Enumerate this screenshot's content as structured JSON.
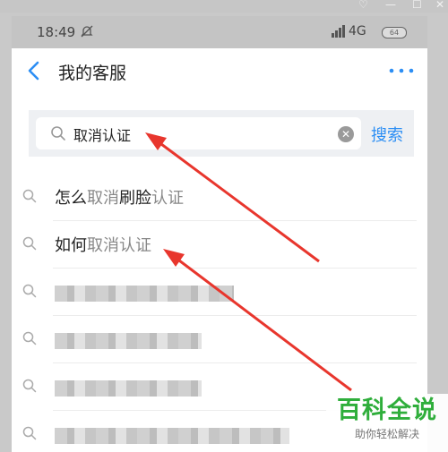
{
  "status": {
    "time": "18:49",
    "network": "4G",
    "battery": "64"
  },
  "header": {
    "title": "我的客服"
  },
  "search": {
    "value": "取消认证",
    "button": "搜索"
  },
  "suggestions": [
    {
      "prefix": "怎么",
      "match": "取消",
      "middle": "刷脸",
      "suffix": "认证"
    },
    {
      "prefix": "如何",
      "match": "取消认证",
      "middle": "",
      "suffix": ""
    }
  ],
  "watermark": {
    "title": "百科全说",
    "subtitle": "助你轻松解决"
  },
  "colors": {
    "accent": "#2c8ef4",
    "arrow": "#e8362d",
    "watermark": "#2fae3b"
  }
}
